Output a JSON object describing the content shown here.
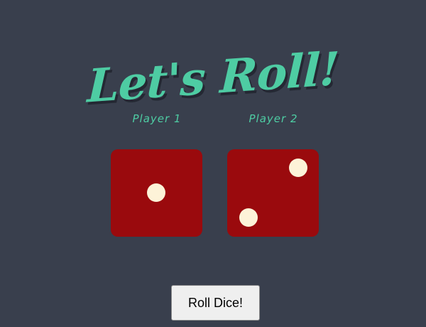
{
  "title": "Let's Roll!",
  "players": [
    {
      "label": "Player 1",
      "die_value": 1
    },
    {
      "label": "Player 2",
      "die_value": 2
    }
  ],
  "roll_button": {
    "label": "Roll Dice!"
  },
  "colors": {
    "background": "#393f4d",
    "accent": "#4ecca3",
    "die": "#9a0a0d",
    "pip": "#fdf3d8"
  }
}
